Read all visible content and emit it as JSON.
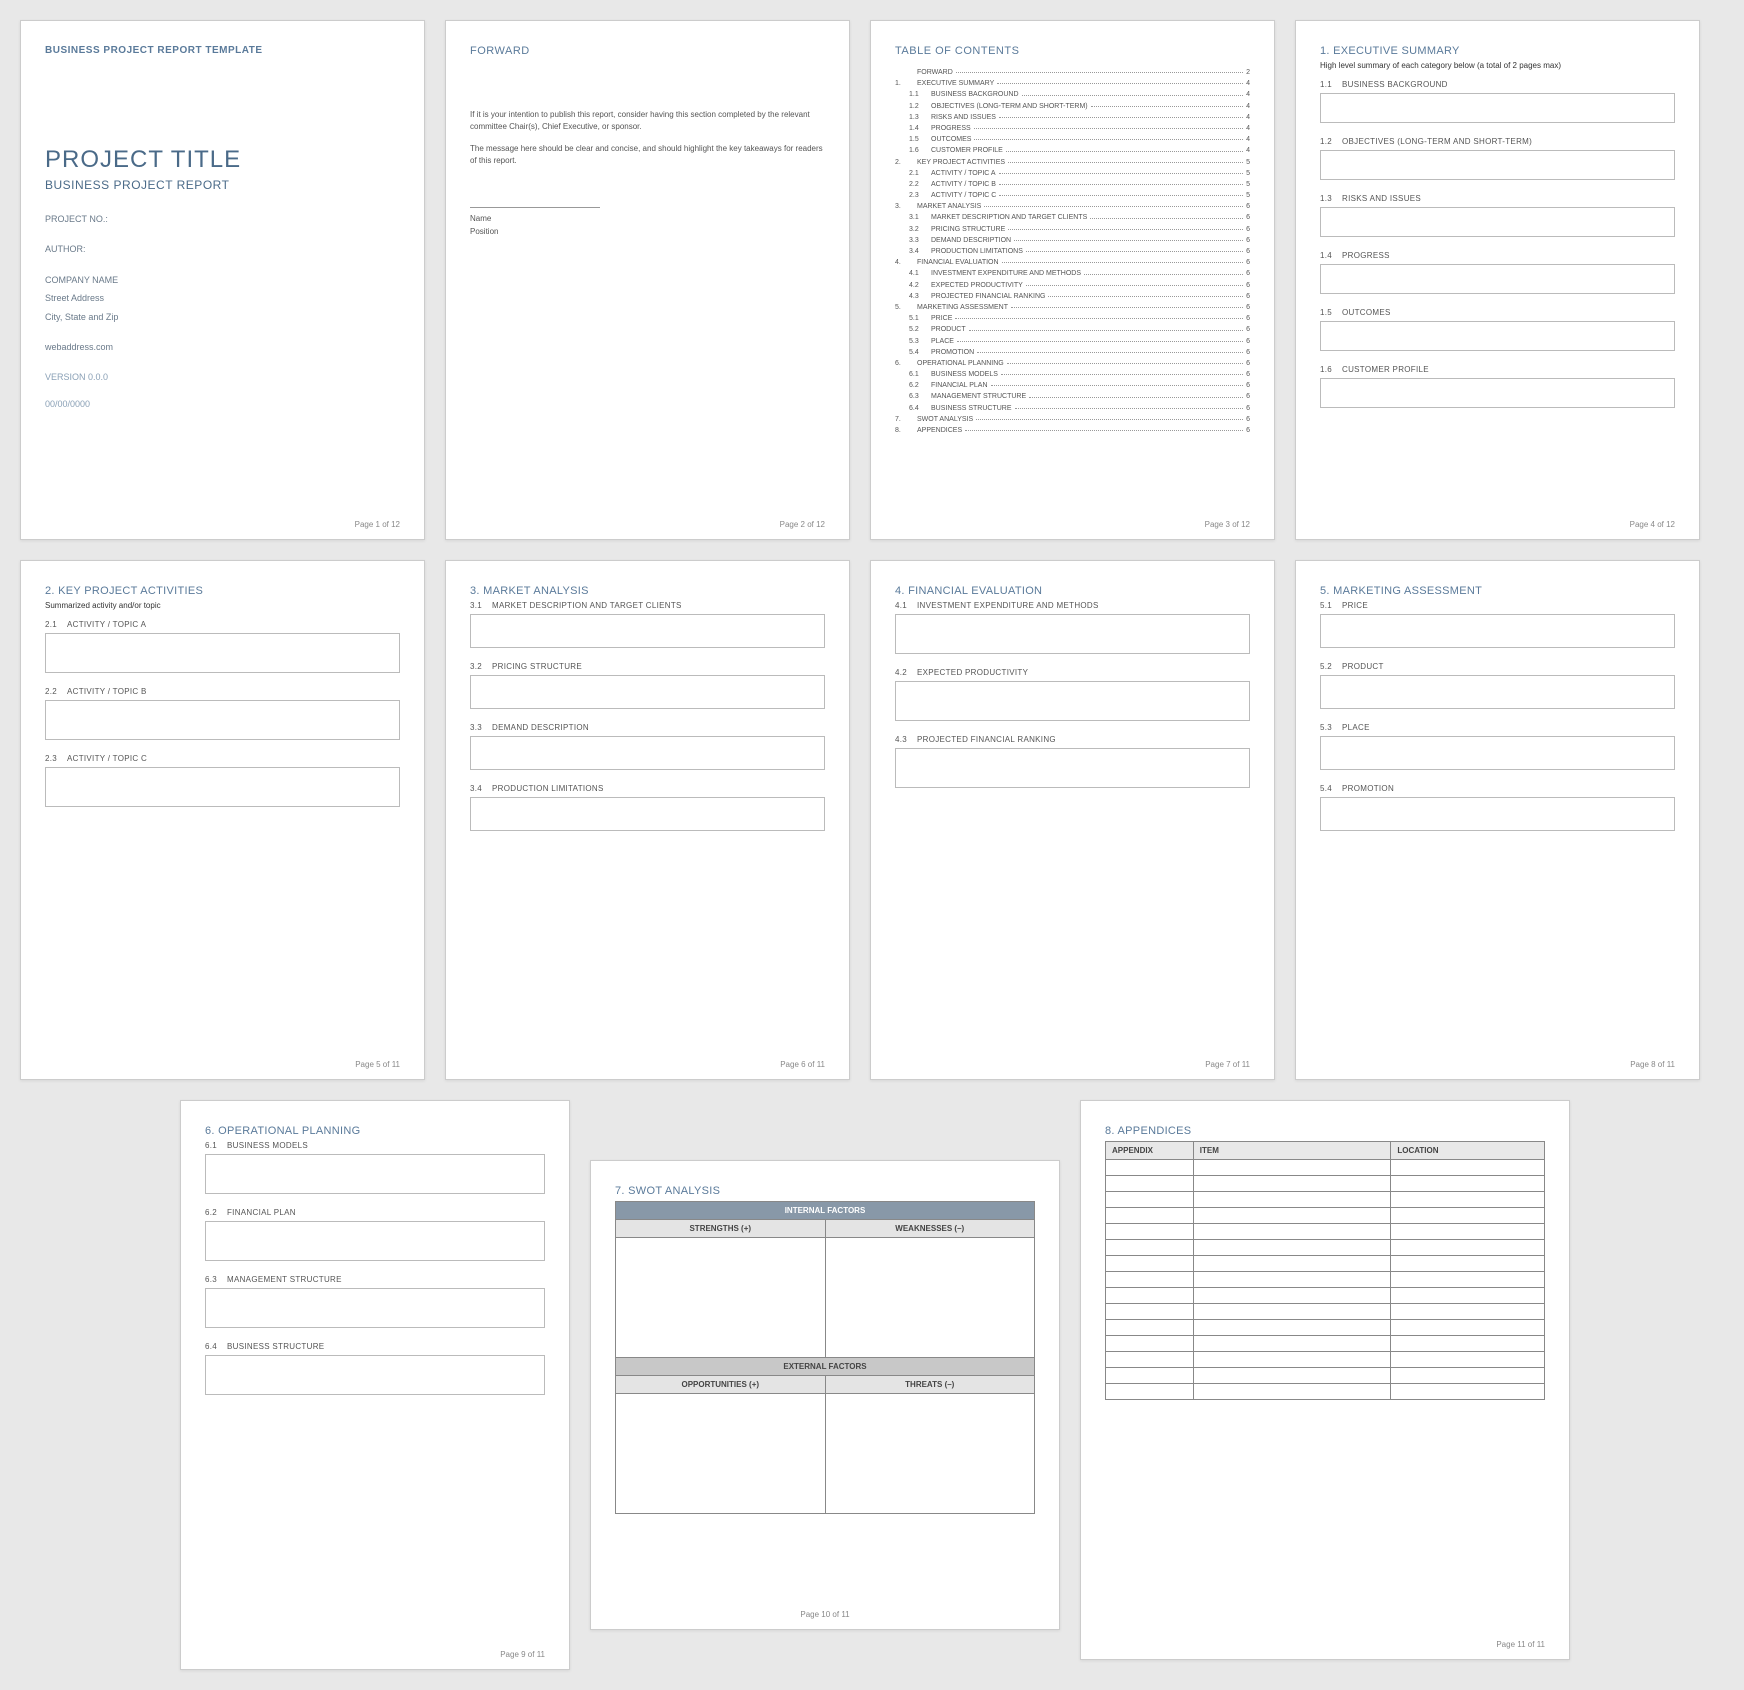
{
  "footer_prefix": "Page ",
  "footer_sep": " of ",
  "p1": {
    "header": "BUSINESS PROJECT REPORT TEMPLATE",
    "title": "PROJECT TITLE",
    "subtitle": "BUSINESS PROJECT REPORT",
    "project_no": "PROJECT NO.:",
    "author": "AUTHOR:",
    "company": "COMPANY NAME",
    "street": "Street Address",
    "citystate": "City, State and Zip",
    "web": "webaddress.com",
    "version": "VERSION 0.0.0",
    "date": "00/00/0000",
    "page": "1",
    "total": "12"
  },
  "p2": {
    "heading": "FORWARD",
    "para1": "If it is your intention to publish this report, consider having this section completed by the relevant committee Chair(s), Chief Executive, or sponsor.",
    "para2": "The message here should be clear and concise, and should highlight the key takeaways for readers of this report.",
    "name_label": "Name",
    "position_label": "Position",
    "page": "2",
    "total": "12"
  },
  "p3": {
    "heading": "TABLE OF CONTENTS",
    "items": [
      {
        "n": "",
        "t": "FORWARD",
        "p": "2",
        "s": 0
      },
      {
        "n": "1.",
        "t": "EXECUTIVE SUMMARY",
        "p": "4",
        "s": 0
      },
      {
        "n": "1.1",
        "t": "BUSINESS BACKGROUND",
        "p": "4",
        "s": 1
      },
      {
        "n": "1.2",
        "t": "OBJECTIVES (LONG-TERM AND SHORT-TERM)",
        "p": "4",
        "s": 1
      },
      {
        "n": "1.3",
        "t": "RISKS AND ISSUES",
        "p": "4",
        "s": 1
      },
      {
        "n": "1.4",
        "t": "PROGRESS",
        "p": "4",
        "s": 1
      },
      {
        "n": "1.5",
        "t": "OUTCOMES",
        "p": "4",
        "s": 1
      },
      {
        "n": "1.6",
        "t": "CUSTOMER PROFILE",
        "p": "4",
        "s": 1
      },
      {
        "n": "2.",
        "t": "KEY PROJECT ACTIVITIES",
        "p": "5",
        "s": 0
      },
      {
        "n": "2.1",
        "t": "ACTIVITY / TOPIC A",
        "p": "5",
        "s": 1
      },
      {
        "n": "2.2",
        "t": "ACTIVITY / TOPIC B",
        "p": "5",
        "s": 1
      },
      {
        "n": "2.3",
        "t": "ACTIVITY / TOPIC C",
        "p": "5",
        "s": 1
      },
      {
        "n": "3.",
        "t": "MARKET ANALYSIS",
        "p": "6",
        "s": 0
      },
      {
        "n": "3.1",
        "t": "MARKET DESCRIPTION AND TARGET CLIENTS",
        "p": "6",
        "s": 1
      },
      {
        "n": "3.2",
        "t": "PRICING STRUCTURE",
        "p": "6",
        "s": 1
      },
      {
        "n": "3.3",
        "t": "DEMAND DESCRIPTION",
        "p": "6",
        "s": 1
      },
      {
        "n": "3.4",
        "t": "PRODUCTION LIMITATIONS",
        "p": "6",
        "s": 1
      },
      {
        "n": "4.",
        "t": "FINANCIAL EVALUATION",
        "p": "6",
        "s": 0
      },
      {
        "n": "4.1",
        "t": "INVESTMENT EXPENDITURE AND METHODS",
        "p": "6",
        "s": 1
      },
      {
        "n": "4.2",
        "t": "EXPECTED PRODUCTIVITY",
        "p": "6",
        "s": 1
      },
      {
        "n": "4.3",
        "t": "PROJECTED FINANCIAL RANKING",
        "p": "6",
        "s": 1
      },
      {
        "n": "5.",
        "t": "MARKETING ASSESSMENT",
        "p": "6",
        "s": 0
      },
      {
        "n": "5.1",
        "t": "PRICE",
        "p": "6",
        "s": 1
      },
      {
        "n": "5.2",
        "t": "PRODUCT",
        "p": "6",
        "s": 1
      },
      {
        "n": "5.3",
        "t": "PLACE",
        "p": "6",
        "s": 1
      },
      {
        "n": "5.4",
        "t": "PROMOTION",
        "p": "6",
        "s": 1
      },
      {
        "n": "6.",
        "t": "OPERATIONAL PLANNING",
        "p": "6",
        "s": 0
      },
      {
        "n": "6.1",
        "t": "BUSINESS MODELS",
        "p": "6",
        "s": 1
      },
      {
        "n": "6.2",
        "t": "FINANCIAL PLAN",
        "p": "6",
        "s": 1
      },
      {
        "n": "6.3",
        "t": "MANAGEMENT STRUCTURE",
        "p": "6",
        "s": 1
      },
      {
        "n": "6.4",
        "t": "BUSINESS STRUCTURE",
        "p": "6",
        "s": 1
      },
      {
        "n": "7.",
        "t": "SWOT ANALYSIS",
        "p": "6",
        "s": 0
      },
      {
        "n": "8.",
        "t": "APPENDICES",
        "p": "6",
        "s": 0
      }
    ],
    "page": "3",
    "total": "12"
  },
  "p4": {
    "title_n": "1.",
    "title": "EXECUTIVE SUMMARY",
    "note": "High level summary of each category below (a total of 2 pages max)",
    "subs": [
      {
        "n": "1.1",
        "t": "BUSINESS BACKGROUND"
      },
      {
        "n": "1.2",
        "t": "OBJECTIVES (LONG-TERM AND SHORT-TERM)"
      },
      {
        "n": "1.3",
        "t": "RISKS AND ISSUES"
      },
      {
        "n": "1.4",
        "t": "PROGRESS"
      },
      {
        "n": "1.5",
        "t": "OUTCOMES"
      },
      {
        "n": "1.6",
        "t": "CUSTOMER PROFILE"
      }
    ],
    "page": "4",
    "total": "12"
  },
  "p5": {
    "title_n": "2.",
    "title": "KEY PROJECT ACTIVITIES",
    "note": "Summarized activity and/or topic",
    "subs": [
      {
        "n": "2.1",
        "t": "ACTIVITY / TOPIC A"
      },
      {
        "n": "2.2",
        "t": "ACTIVITY / TOPIC B"
      },
      {
        "n": "2.3",
        "t": "ACTIVITY / TOPIC C"
      }
    ],
    "page": "5",
    "total": "11"
  },
  "p6": {
    "title_n": "3.",
    "title": "MARKET ANALYSIS",
    "subs": [
      {
        "n": "3.1",
        "t": "MARKET DESCRIPTION AND TARGET CLIENTS"
      },
      {
        "n": "3.2",
        "t": "PRICING STRUCTURE"
      },
      {
        "n": "3.3",
        "t": "DEMAND DESCRIPTION"
      },
      {
        "n": "3.4",
        "t": "PRODUCTION LIMITATIONS"
      }
    ],
    "page": "6",
    "total": "11"
  },
  "p7": {
    "title_n": "4.",
    "title": "FINANCIAL EVALUATION",
    "subs": [
      {
        "n": "4.1",
        "t": "INVESTMENT EXPENDITURE AND METHODS"
      },
      {
        "n": "4.2",
        "t": "EXPECTED PRODUCTIVITY"
      },
      {
        "n": "4.3",
        "t": "PROJECTED FINANCIAL RANKING"
      }
    ],
    "page": "7",
    "total": "11"
  },
  "p8": {
    "title_n": "5.",
    "title": "MARKETING ASSESSMENT",
    "subs": [
      {
        "n": "5.1",
        "t": "PRICE"
      },
      {
        "n": "5.2",
        "t": "PRODUCT"
      },
      {
        "n": "5.3",
        "t": "PLACE"
      },
      {
        "n": "5.4",
        "t": "PROMOTION"
      }
    ],
    "page": "8",
    "total": "11"
  },
  "p9": {
    "title_n": "6.",
    "title": "OPERATIONAL PLANNING",
    "subs": [
      {
        "n": "6.1",
        "t": "BUSINESS MODELS"
      },
      {
        "n": "6.2",
        "t": "FINANCIAL PLAN"
      },
      {
        "n": "6.3",
        "t": "MANAGEMENT STRUCTURE"
      },
      {
        "n": "6.4",
        "t": "BUSINESS STRUCTURE"
      }
    ],
    "page": "9",
    "total": "11"
  },
  "p10": {
    "title_n": "7.",
    "title": "SWOT ANALYSIS",
    "internal": "INTERNAL FACTORS",
    "external": "EXTERNAL FACTORS",
    "strengths": "STRENGTHS (+)",
    "weaknesses": "WEAKNESSES (–)",
    "opportunities": "OPPORTUNITIES (+)",
    "threats": "THREATS (–)",
    "page": "10",
    "total": "11"
  },
  "p11": {
    "title_n": "8.",
    "title": "APPENDICES",
    "col1": "APPENDIX",
    "col2": "ITEM",
    "col3": "LOCATION",
    "rows": 15,
    "page": "11",
    "total": "11"
  }
}
